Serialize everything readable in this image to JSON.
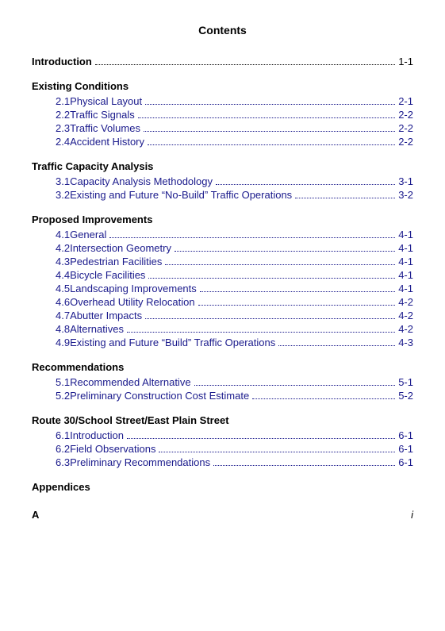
{
  "title": "Contents",
  "intro": {
    "label": "Introduction",
    "dots": true,
    "page": "1-1"
  },
  "sections": [
    {
      "heading": "Existing Conditions",
      "entries": [
        {
          "number": "2.1",
          "title": "Physical Layout",
          "page": "2-1"
        },
        {
          "number": "2.2",
          "title": "Traffic Signals",
          "page": "2-2"
        },
        {
          "number": "2.3",
          "title": "Traffic Volumes",
          "page": "2-2"
        },
        {
          "number": "2.4",
          "title": "Accident History",
          "page": "2-2"
        }
      ]
    },
    {
      "heading": "Traffic Capacity Analysis",
      "entries": [
        {
          "number": "3.1",
          "title": "Capacity Analysis Methodology",
          "page": "3-1"
        },
        {
          "number": "3.2",
          "title": "Existing and Future “No-Build” Traffic Operations",
          "page": "3-2"
        }
      ]
    },
    {
      "heading": "Proposed Improvements",
      "entries": [
        {
          "number": "4.1",
          "title": "General",
          "page": "4-1"
        },
        {
          "number": "4.2",
          "title": "Intersection Geometry",
          "page": "4-1"
        },
        {
          "number": "4.3",
          "title": "Pedestrian Facilities",
          "page": "4-1"
        },
        {
          "number": "4.4",
          "title": "Bicycle Facilities",
          "page": "4-1"
        },
        {
          "number": "4.5",
          "title": "Landscaping Improvements",
          "page": "4-1"
        },
        {
          "number": "4.6",
          "title": "Overhead Utility Relocation",
          "page": "4-2"
        },
        {
          "number": "4.7",
          "title": "Abutter Impacts",
          "page": "4-2"
        },
        {
          "number": "4.8",
          "title": "Alternatives",
          "page": "4-2"
        },
        {
          "number": "4.9",
          "title": "Existing and Future “Build” Traffic Operations",
          "page": "4-3"
        }
      ]
    },
    {
      "heading": "Recommendations",
      "entries": [
        {
          "number": "5.1",
          "title": "Recommended Alternative",
          "page": "5-1"
        },
        {
          "number": "5.2",
          "title": "Preliminary Construction Cost Estimate",
          "page": "5-2"
        }
      ]
    },
    {
      "heading": "Route 30/School Street/East Plain Street",
      "entries": [
        {
          "number": "6.1",
          "title": "Introduction",
          "page": "6-1"
        },
        {
          "number": "6.2",
          "title": "Field Observations",
          "page": "6-1"
        },
        {
          "number": "6.3",
          "title": "Preliminary Recommendations",
          "page": "6-1"
        }
      ]
    },
    {
      "heading": "Appendices",
      "entries": []
    }
  ],
  "footer": {
    "left": "A",
    "right": "i"
  }
}
